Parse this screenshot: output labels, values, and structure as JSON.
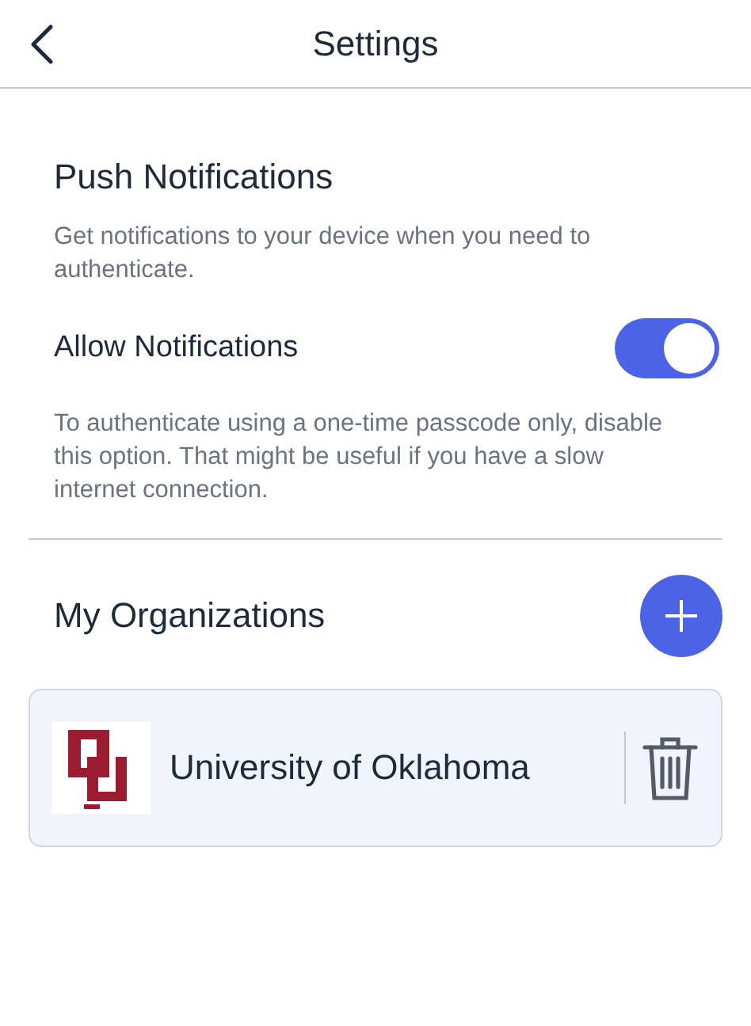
{
  "header": {
    "title": "Settings"
  },
  "push": {
    "title": "Push Notifications",
    "description": "Get notifications to your device when you need to authenticate.",
    "toggle": {
      "label": "Allow Notifications",
      "on": true
    },
    "note": "To authenticate using a one-time passcode only, disable this option. That might be useful if you have a slow internet connection."
  },
  "organizations": {
    "title": "My Organizations",
    "items": [
      {
        "name": "University of Oklahoma"
      }
    ]
  }
}
